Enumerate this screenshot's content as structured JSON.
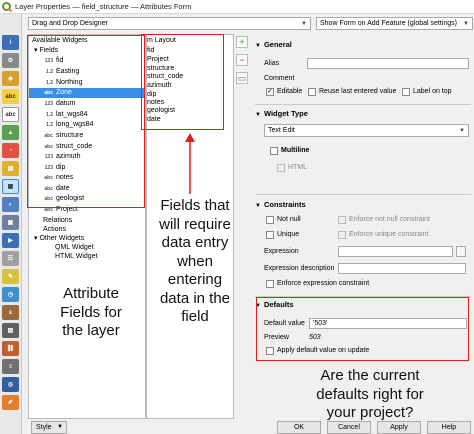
{
  "window": {
    "title": "Layer Properties — field_structure — Attributes Form"
  },
  "top": {
    "designer_mode": "Drag and Drop Designer",
    "show_form": "Show Form on Add Feature (global settings)"
  },
  "available_widgets": {
    "header": "Available Widgets",
    "fields_group": "Fields",
    "fields": [
      {
        "type": "123",
        "name": "fid"
      },
      {
        "type": "1.2",
        "name": "Easting"
      },
      {
        "type": "1.2",
        "name": "Northing"
      },
      {
        "type": "abc",
        "name": "Zone"
      },
      {
        "type": "123",
        "name": "datum"
      },
      {
        "type": "1.2",
        "name": "lat_wgs84"
      },
      {
        "type": "1.2",
        "name": "long_wgs84"
      },
      {
        "type": "abc",
        "name": "structure"
      },
      {
        "type": "abc",
        "name": "struct_code"
      },
      {
        "type": "123",
        "name": "azimuth"
      },
      {
        "type": "123",
        "name": "dip"
      },
      {
        "type": "abc",
        "name": "notes"
      },
      {
        "type": "abc",
        "name": "date"
      },
      {
        "type": "abc",
        "name": "geologist"
      },
      {
        "type": "abc",
        "name": "Project"
      }
    ],
    "other_groups": [
      "Relations",
      "Actions",
      "Other Widgets"
    ],
    "other_widgets": [
      "QML Widget",
      "HTML Widget"
    ]
  },
  "form_layout": {
    "header": "Form Layout",
    "header_visible": "m Layout",
    "items": [
      "fid",
      "Project",
      "structure",
      "struct_code",
      "azimuth",
      "dip",
      "notes",
      "geologist",
      "date"
    ]
  },
  "general": {
    "title": "General",
    "alias_label": "Alias",
    "comment_label": "Comment",
    "editable_label": "Editable",
    "reuse_label": "Reuse last entered value",
    "label_on_top": "Label on top"
  },
  "widget_type": {
    "title": "Widget Type",
    "value": "Text Edit",
    "multiline": "Multiline",
    "html": "HTML"
  },
  "constraints": {
    "title": "Constraints",
    "not_null": "Not null",
    "enforce_not_null": "Enforce not null constraint",
    "unique": "Unique",
    "enforce_unique": "Enforce unique constraint",
    "expression_label": "Expression",
    "expression_desc_label": "Expression description",
    "enforce_expression": "Enforce expression constraint"
  },
  "defaults": {
    "title": "Defaults",
    "default_value_label": "Default value",
    "default_value": "'503'",
    "preview_label": "Preview",
    "preview_value": "503",
    "apply_on_update": "Apply default value on update"
  },
  "annotations": {
    "attribute_fields": [
      "Attribute",
      "Fields for",
      "the layer"
    ],
    "data_entry": [
      "Fields that",
      "will require",
      "data entry",
      "when",
      "entering",
      "data in the",
      "field"
    ],
    "defaults_question": [
      "Are the current",
      "defaults right for",
      "your project?"
    ]
  },
  "buttons": {
    "style": "Style",
    "ok": "OK",
    "cancel": "Cancel",
    "apply": "Apply",
    "help": "Help"
  },
  "colors": {
    "selection": "#3a8ee6",
    "annotation_box": "#e02020"
  },
  "left_toolbar_icons": [
    "information-icon",
    "source-icon",
    "symbology-icon",
    "labels-icon",
    "masks-icon",
    "3d-view-icon",
    "diagrams-icon",
    "fields-icon",
    "attributes-form-icon",
    "joins-icon",
    "auxiliary-storage-icon",
    "actions-icon",
    "display-icon",
    "rendering-icon",
    "temporal-icon",
    "variables-icon",
    "metadata-icon",
    "dependencies-icon",
    "legend-icon",
    "qgis-server-icon",
    "digitizing-icon"
  ]
}
